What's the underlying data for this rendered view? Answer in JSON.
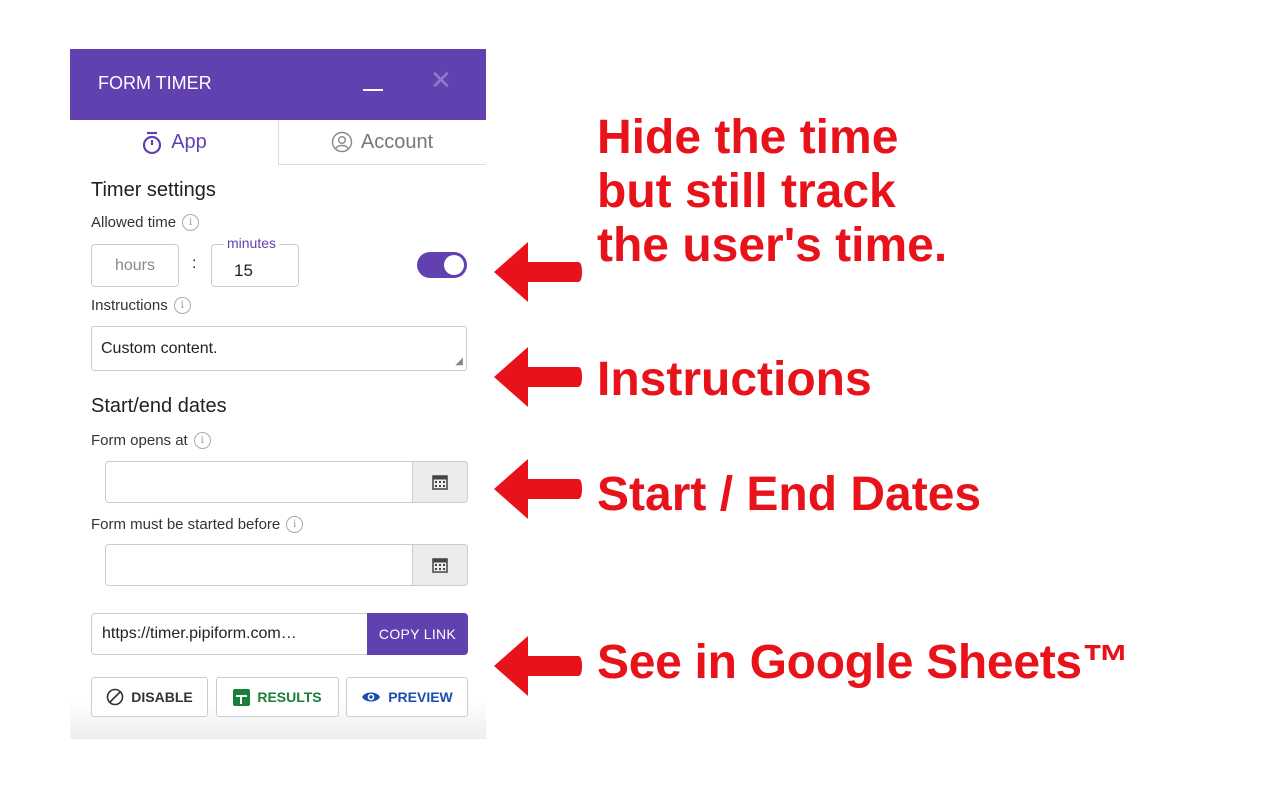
{
  "panel": {
    "title": "FORM TIMER",
    "minimize_icon": "minimize-icon",
    "close_icon": "close-icon",
    "tabs": [
      {
        "label": "App",
        "icon": "timer-icon",
        "active": true
      },
      {
        "label": "Account",
        "icon": "account-icon",
        "active": false
      }
    ],
    "timer_settings": {
      "heading": "Timer settings",
      "allowed_time_label": "Allowed time",
      "hours_placeholder": "hours",
      "separator": ":",
      "minutes_label": "minutes",
      "minutes_value": "15",
      "hide_timer_toggle_on": true
    },
    "instructions": {
      "label": "Instructions",
      "value": "Custom content."
    },
    "dates": {
      "heading": "Start/end dates",
      "opens_label": "Form opens at",
      "opens_value": "",
      "started_before_label": "Form must be started before",
      "started_before_value": ""
    },
    "link": {
      "url": "https://timer.pipiform.com…",
      "copy_label": "COPY LINK"
    },
    "actions": [
      {
        "label": "DISABLE",
        "icon": "disable-icon"
      },
      {
        "label": "RESULTS",
        "icon": "sheets-icon"
      },
      {
        "label": "PREVIEW",
        "icon": "eye-icon"
      }
    ]
  },
  "annotations": [
    {
      "lines": [
        "Hide the time",
        "but still track",
        "the user's time."
      ]
    },
    {
      "lines": [
        "Instructions"
      ]
    },
    {
      "lines": [
        "Start / End Dates"
      ]
    },
    {
      "lines": [
        "See in Google Sheets™"
      ]
    }
  ],
  "colors": {
    "accent": "#6141b0",
    "annotation": "#e8121a",
    "results_green": "#188038",
    "preview_blue": "#1a4fb0"
  }
}
